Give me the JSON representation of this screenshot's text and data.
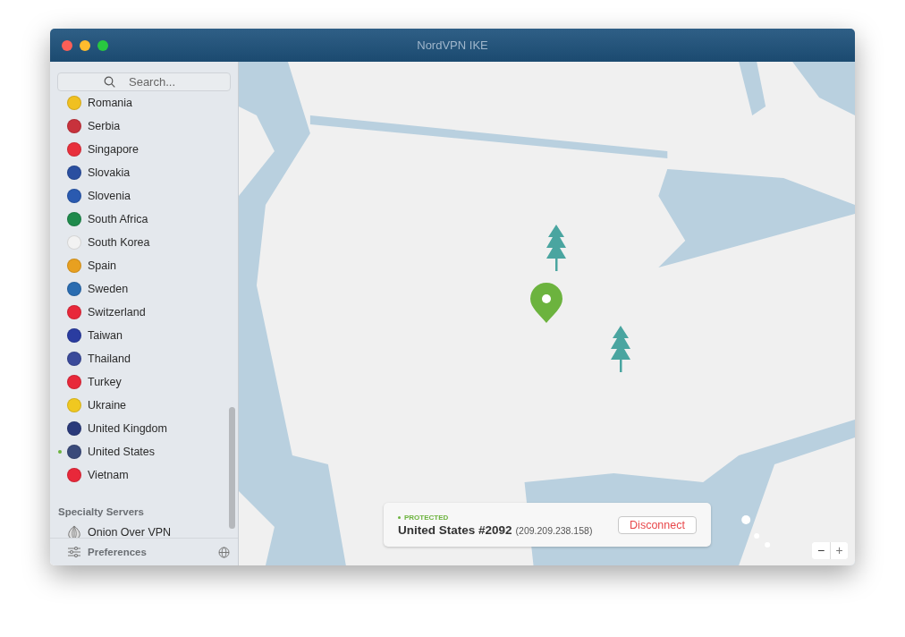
{
  "window": {
    "title": "NordVPN IKE"
  },
  "search": {
    "placeholder": "Search..."
  },
  "countries": [
    {
      "name": "Romania",
      "color": "#f0c020",
      "connected": false
    },
    {
      "name": "Serbia",
      "color": "#c8323c",
      "connected": false
    },
    {
      "name": "Singapore",
      "color": "#e8303c",
      "connected": false
    },
    {
      "name": "Slovakia",
      "color": "#2a4fa0",
      "connected": false
    },
    {
      "name": "Slovenia",
      "color": "#2a5ab0",
      "connected": false
    },
    {
      "name": "South Africa",
      "color": "#1f8a4c",
      "connected": false
    },
    {
      "name": "South Korea",
      "color": "#f2f2f2",
      "connected": false
    },
    {
      "name": "Spain",
      "color": "#e8a020",
      "connected": false
    },
    {
      "name": "Sweden",
      "color": "#2a6cb0",
      "connected": false
    },
    {
      "name": "Switzerland",
      "color": "#e8283a",
      "connected": false
    },
    {
      "name": "Taiwan",
      "color": "#2a3ca0",
      "connected": false
    },
    {
      "name": "Thailand",
      "color": "#3a4a9a",
      "connected": false
    },
    {
      "name": "Turkey",
      "color": "#e8283a",
      "connected": false
    },
    {
      "name": "Ukraine",
      "color": "#f0c820",
      "connected": false
    },
    {
      "name": "United Kingdom",
      "color": "#2a3a7a",
      "connected": false
    },
    {
      "name": "United States",
      "color": "#3a4a7a",
      "connected": true
    },
    {
      "name": "Vietnam",
      "color": "#e8283a",
      "connected": false
    }
  ],
  "specialty": {
    "heading": "Specialty Servers",
    "items": [
      {
        "name": "Onion Over VPN"
      }
    ]
  },
  "footer": {
    "preferences": "Preferences"
  },
  "status": {
    "state": "PROTECTED",
    "server": "United States #2092",
    "ip": "(209.209.238.158)",
    "button": "Disconnect"
  },
  "zoom": {
    "minus": "−",
    "plus": "+"
  }
}
